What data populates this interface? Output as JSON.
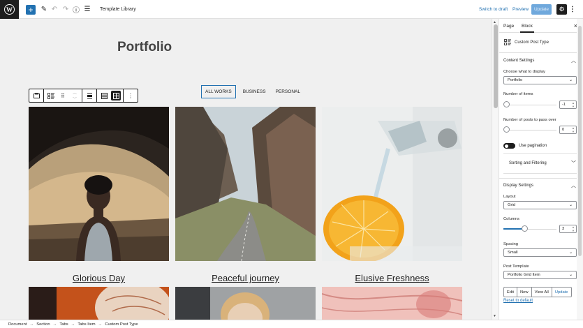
{
  "topbar": {
    "document_title": "Template Library",
    "switch_to_draft": "Switch to draft",
    "preview": "Preview",
    "update": "Update",
    "add_icon": "+",
    "edit_icon": "✎",
    "undo_icon": "↶",
    "redo_icon": "↷",
    "info_icon": "ⓘ",
    "list_icon": "☰",
    "settings_icon": "⚙",
    "more_icon": "⋮"
  },
  "canvas": {
    "heading": "Portfolio",
    "filter_tabs": [
      "ALL WORKS",
      "BUSINESS",
      "PERSONAL"
    ],
    "cards": [
      {
        "title": "Glorious Day"
      },
      {
        "title": "Peaceful journey"
      },
      {
        "title": "Elusive Freshness"
      }
    ]
  },
  "sidebar": {
    "tabs": [
      "Page",
      "Block"
    ],
    "active_tab": "Block",
    "close_icon": "×",
    "block_name": "Custom Post Type",
    "content_settings": {
      "title": "Content Settings",
      "choose_label": "Choose what to display",
      "choose_value": "Portfolio",
      "items_label": "Number of items",
      "items_value": "-1",
      "pass_over_label": "Number of posts to pass over",
      "pass_over_value": "0",
      "use_pagination": "Use pagination",
      "sorting_title": "Sorting and Filtering"
    },
    "display_settings": {
      "title": "Display Settings",
      "layout_label": "Layout",
      "layout_value": "Grid",
      "columns_label": "Columns",
      "columns_value": "3",
      "columns_fraction": 0.4,
      "spacing_label": "Spacing",
      "spacing_value": "Small",
      "template_label": "Post Template",
      "template_value": "Portfolio Grid Item",
      "template_buttons": [
        "Edit",
        "New",
        "View All",
        "Update"
      ],
      "reset_link": "Reset to default"
    }
  },
  "breadcrumbs": [
    "Document",
    "Section",
    "Tabs",
    "Tabs Item",
    "Custom Post Type"
  ],
  "breadcrumb_separator": "→"
}
